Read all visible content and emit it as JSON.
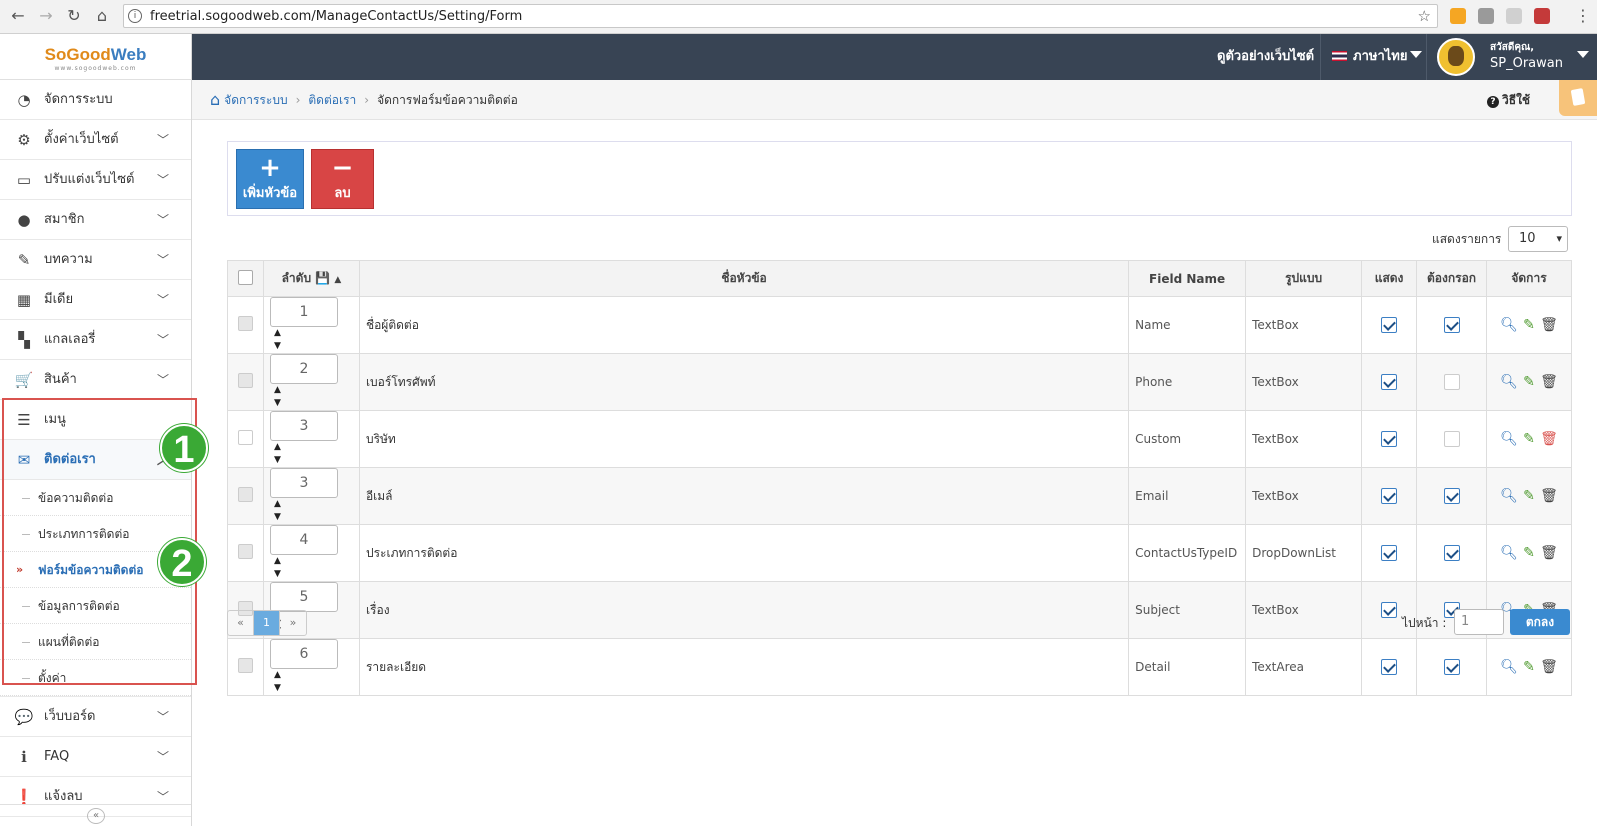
{
  "browser": {
    "url": "freetrial.sogoodweb.com/ManageContactUs/Setting/Form"
  },
  "logo": {
    "part1": "SoGood",
    "part2": "Web",
    "tagline": "www.sogoodweb.com"
  },
  "topbar": {
    "view_site": "ดูตัวอย่างเว็บไซต์",
    "language": "ภาษาไทย",
    "greeting": "สวัสดีคุณ,",
    "username": "SP_Orawan"
  },
  "breadcrumb": {
    "items": [
      "จัดการระบบ",
      "ติดต่อเรา",
      "จัดการฟอร์มข้อความติดต่อ"
    ],
    "help": "วิธีใช้"
  },
  "sidebar": {
    "items": [
      {
        "label": "จัดการระบบ",
        "icon": "dashboard-icon"
      },
      {
        "label": "ตั้งค่าเว็บไซต์",
        "icon": "gear-icon"
      },
      {
        "label": "ปรับแต่งเว็บไซต์",
        "icon": "monitor-icon"
      },
      {
        "label": "สมาชิก",
        "icon": "user-icon"
      },
      {
        "label": "บทความ",
        "icon": "edit-icon"
      },
      {
        "label": "มีเดีย",
        "icon": "film-icon"
      },
      {
        "label": "แกลเลอรี่",
        "icon": "grid-icon"
      },
      {
        "label": "สินค้า",
        "icon": "cart-icon"
      },
      {
        "label": "เมนู",
        "icon": "menu-icon"
      },
      {
        "label": "ติดต่อเรา",
        "icon": "envelope-icon"
      },
      {
        "label": "เว็บบอร์ด",
        "icon": "chat-icon"
      },
      {
        "label": "FAQ",
        "icon": "info-icon"
      },
      {
        "label": "แจ้งลบ",
        "icon": "alert-icon"
      }
    ],
    "submenu": [
      "ข้อความติดต่อ",
      "ประเภทการติดต่อ",
      "ฟอร์มข้อความติดต่อ",
      "ข้อมูลการติดต่อ",
      "แผนที่ติดต่อ",
      "ตั้งค่า"
    ],
    "badges": [
      "1",
      "2"
    ]
  },
  "toolbar": {
    "add_label": "เพิ่มหัวข้อ",
    "delete_label": "ลบ"
  },
  "list": {
    "page_size_label": "แสดงรายการ",
    "page_size": "10",
    "columns": [
      "ลำดับ",
      "ชื่อหัวข้อ",
      "Field Name",
      "รูปแบบ",
      "แสดง",
      "ต้องกรอก",
      "จัดการ"
    ],
    "rows": [
      {
        "order": "1",
        "title": "ชื่อผู้ติดต่อ",
        "field": "Name",
        "type": "TextBox",
        "show": true,
        "required": true
      },
      {
        "order": "2",
        "title": "เบอร์โทรศัพท์",
        "field": "Phone",
        "type": "TextBox",
        "show": true,
        "required": false
      },
      {
        "order": "3",
        "title": "บริษัท",
        "field": "Custom",
        "type": "TextBox",
        "show": true,
        "required": false
      },
      {
        "order": "3",
        "title": "อีเมล์",
        "field": "Email",
        "type": "TextBox",
        "show": true,
        "required": true
      },
      {
        "order": "4",
        "title": "ประเภทการติดต่อ",
        "field": "ContactUsTypeID",
        "type": "DropDownList",
        "show": true,
        "required": true
      },
      {
        "order": "5",
        "title": "เรื่อง",
        "field": "Subject",
        "type": "TextBox",
        "show": true,
        "required": true
      },
      {
        "order": "6",
        "title": "รายละเอียด",
        "field": "Detail",
        "type": "TextArea",
        "show": true,
        "required": true
      }
    ]
  },
  "pager": {
    "prev": "«",
    "current": "1",
    "next": "»",
    "goto_label": "ไปหน้า :",
    "goto_value": "1",
    "goto_button": "ตกลง"
  }
}
